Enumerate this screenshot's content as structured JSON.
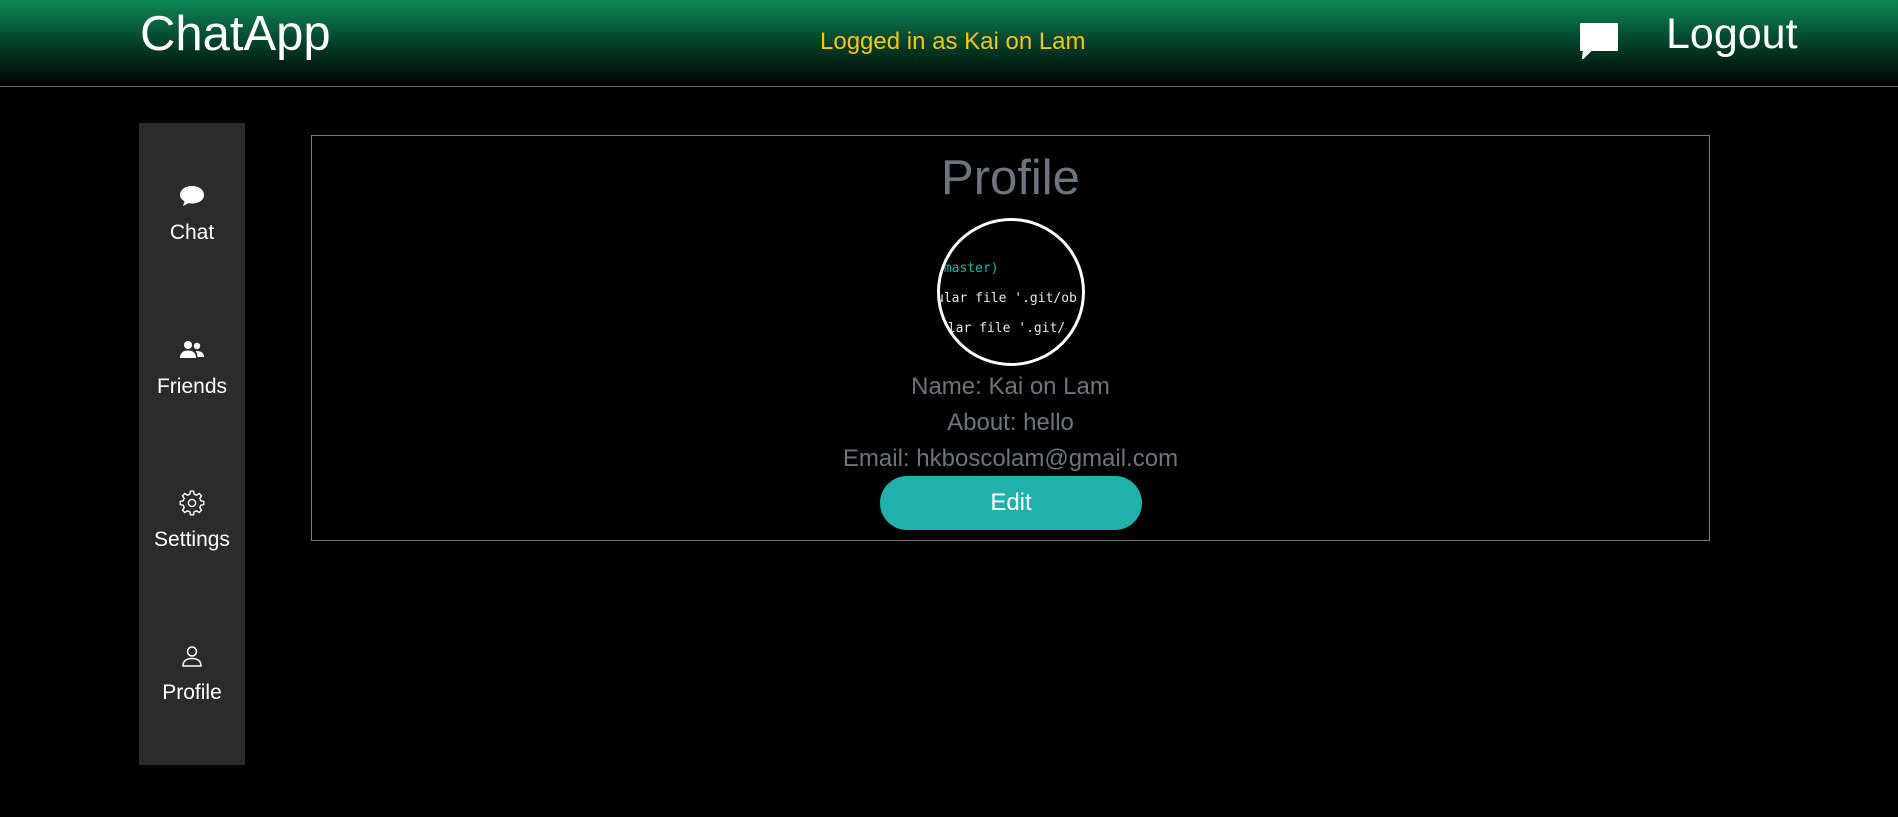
{
  "header": {
    "brand": "ChatApp",
    "logged_in_text": "Logged in as Kai on Lam",
    "chat_icon": "chat-bubble-icon",
    "logout_label": "Logout"
  },
  "sidebar": {
    "items": [
      {
        "label": "Chat",
        "icon": "chat-icon"
      },
      {
        "label": "Friends",
        "icon": "friends-icon"
      },
      {
        "label": "Settings",
        "icon": "gear-icon"
      },
      {
        "label": "Profile",
        "icon": "user-icon"
      }
    ]
  },
  "profile": {
    "title": "Profile",
    "avatar_lines": [
      "(master)",
      "ular file '.git/ob",
      "ular file '.git/"
    ],
    "name_line": "Name: Kai on Lam",
    "about_line": "About: hello",
    "email_line": "Email: hkboscolam@gmail.com",
    "edit_label": "Edit"
  },
  "colors": {
    "accent": "#20b2aa",
    "logged_in_text": "#f5c518",
    "header_gradient_top": "#0c8a58",
    "sidebar_bg": "#2b2b2b",
    "muted_text": "#6c757d"
  }
}
